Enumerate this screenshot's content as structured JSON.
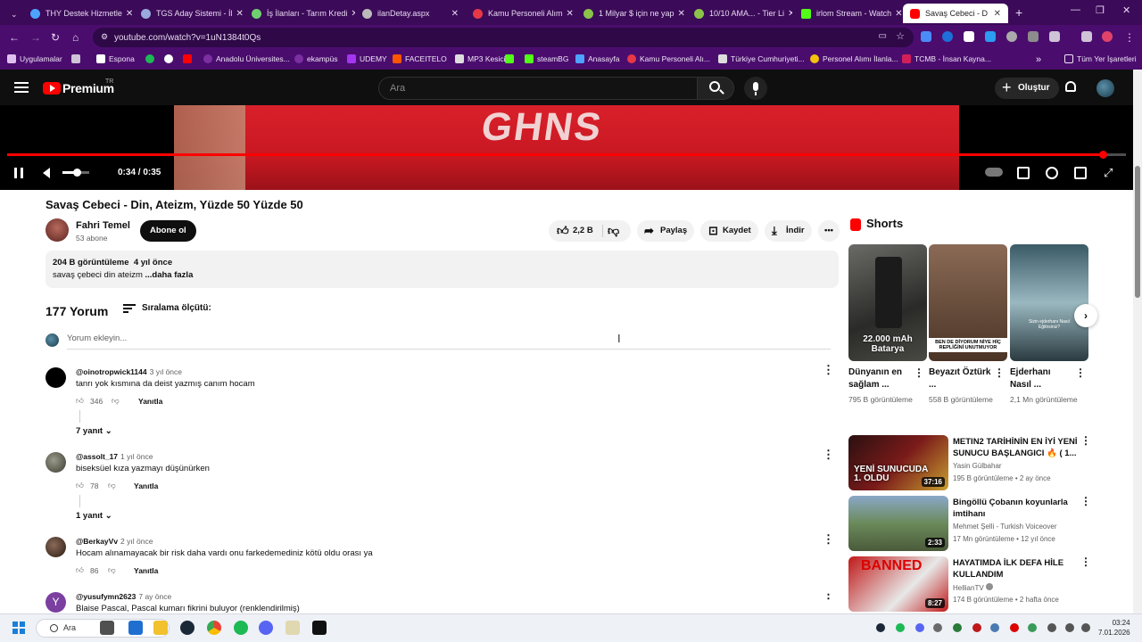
{
  "browser": {
    "tabs": [
      {
        "label": "THY Destek Hizmetle",
        "icon": "thy-icon"
      },
      {
        "label": "TGS Aday Sistemi - İl",
        "icon": "tgs-icon"
      },
      {
        "label": "İş İlanları - Tarım Kredi",
        "icon": "globe-icon"
      },
      {
        "label": "ilanDetay.aspx",
        "icon": "globe-icon"
      },
      {
        "label": "Kamu Personeli Alım",
        "icon": "kamu-icon"
      },
      {
        "label": "1 Milyar $ için ne yap",
        "icon": "globe-icon"
      },
      {
        "label": "10/10 AMA... - Tier Li",
        "icon": "globe-icon"
      },
      {
        "label": "irlom Stream - Watch",
        "icon": "kick-icon"
      },
      {
        "label": "Savaş Cebeci - D",
        "icon": "youtube-icon"
      }
    ],
    "url": "youtube.com/watch?v=1uN1384t0Qs",
    "bookmarks": [
      "Uygulamalar",
      "Espona",
      "Anadolu Üniversites...",
      "ekampüs",
      "UDEMY",
      "FACEITELO",
      "MP3 Kesici",
      "steamBG",
      "Anasayfa",
      "Kamu Personeli Alı...",
      "Türkiye Cumhuriyeti...",
      "Personel Alımı İlanla...",
      "TCMB - İnsan Kayna..."
    ],
    "all_bookmarks": "Tüm Yer İşaretleri"
  },
  "header": {
    "brand": "Premium",
    "region": "TR",
    "search_placeholder": "Ara",
    "create_label": "Oluştur"
  },
  "player": {
    "time": "0:34 / 0:35",
    "progress": 0.98,
    "volume": 0.5,
    "overlay_text": "GHNS"
  },
  "video": {
    "title": "Savaş Cebeci - Din, Ateizm, Yüzde 50 Yüzde 50",
    "channel": "Fahri Temel",
    "subscribers": "53 abone",
    "subscribe_label": "Abone ol",
    "likes": "2,2 B",
    "share_label": "Paylaş",
    "save_label": "Kaydet",
    "download_label": "İndir",
    "views": "204 B görüntüleme",
    "age": "4 yıl önce",
    "description": "savaş çebeci din ateizm",
    "more_label": "...daha fazla"
  },
  "comments": {
    "count": "177 Yorum",
    "sort_label": "Sıralama ölçütü:",
    "input_placeholder": "Yorum ekleyin...",
    "reply_label": "Yanıtla",
    "items": [
      {
        "user": "@oinotropwick1144",
        "time": "3 yıl önce",
        "text": "tanrı yok kısmına da deist yazmış canım hocam",
        "likes": "346",
        "replies": "7 yanıt"
      },
      {
        "user": "@assolt_17",
        "time": "1 yıl önce",
        "text": "biseksüel kıza yazmayı düşünürken",
        "likes": "78",
        "replies": "1 yanıt"
      },
      {
        "user": "@BerkayVv",
        "time": "2 yıl önce",
        "text": "Hocam alınamayacak bir risk daha vardı onu farkedemediniz kötü oldu orası ya",
        "likes": "86",
        "replies": ""
      },
      {
        "user": "@yusufymn2623",
        "time": "7 ay önce",
        "text": "Blaise Pascal, Pascal kumarı fikrini buluyor (renklendirilmiş)",
        "likes": "",
        "replies": "",
        "avatar_letter": "Y"
      }
    ]
  },
  "shorts": {
    "title": "Shorts",
    "items": [
      {
        "title": "Dünyanın en sağlam ...",
        "views": "795 B görüntüleme",
        "thumb_text": "22.000 mAh Batarya"
      },
      {
        "title": "Beyazıt Öztürk ...",
        "views": "558 B görüntüleme",
        "thumb_text": "BEN DE DİYORUM NİYE HİÇ REPLİĞİNİ UNUTMUYOR"
      },
      {
        "title": "Ejderhanı Nasıl ...",
        "views": "2,1 Mn görüntüleme",
        "thumb_text": "Sizin ejderhanı Nasıl Eğitirsiniz?"
      }
    ]
  },
  "recommended": [
    {
      "title": "METIN2 TARİHİNİN EN İYİ YENİ SUNUCU BAŞLANGICI 🔥 ( 1...",
      "channel": "Yasin Gülbahar",
      "meta": "195 B görüntüleme • 2 ay önce",
      "duration": "37:16",
      "thumb_text": "YENİ SUNUCUDA 1. OLDU"
    },
    {
      "title": "Bingöllü Çobanın koyunlarla imtihanı",
      "channel": "Mehmet Şelli - Turkish Voiceover",
      "meta": "17 Mn görüntüleme • 12 yıl önce",
      "duration": "2:33",
      "thumb_text": ""
    },
    {
      "title": "HAYATIMDA İLK DEFA HİLE KULLANDIM",
      "channel": "HellianTV",
      "meta": "174 B görüntüleme • 2 hafta önce",
      "duration": "8:27",
      "thumb_text": "BANNED"
    }
  ],
  "taskbar": {
    "search_label": "Ara",
    "time": "03:24",
    "date": "7.01.2026"
  }
}
